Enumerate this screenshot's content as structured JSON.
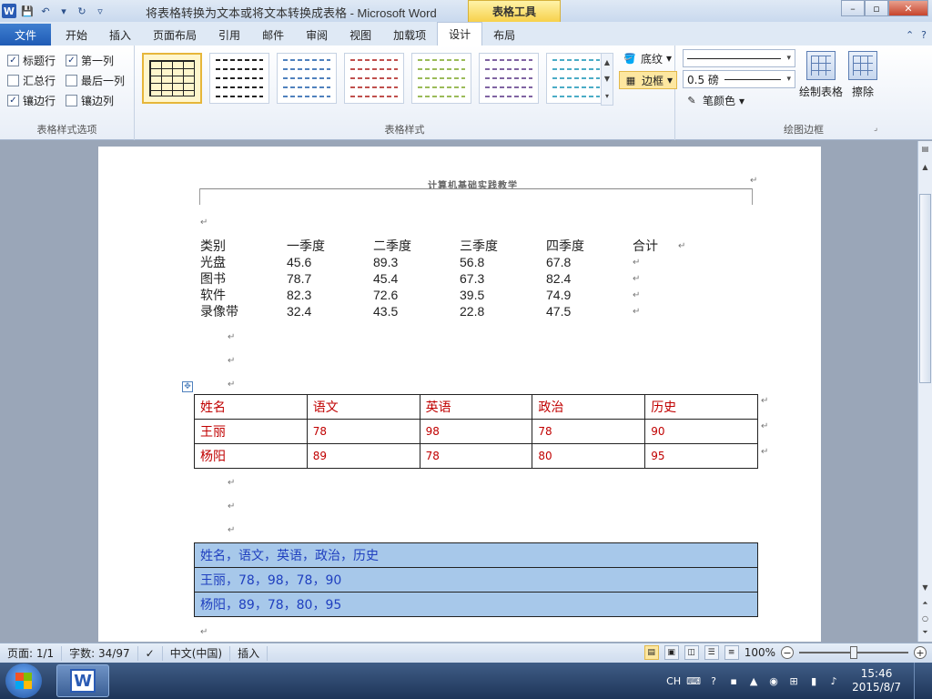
{
  "window": {
    "title": "将表格转换为文本或将文本转换成表格 - Microsoft Word",
    "context_tab": "表格工具",
    "word_icon": "W",
    "controls": {
      "minimize": "–",
      "restore": "▫",
      "close": "✕"
    }
  },
  "ribbon_tabs": {
    "file": "文件",
    "items": [
      "开始",
      "插入",
      "页面布局",
      "引用",
      "邮件",
      "审阅",
      "视图",
      "加载项",
      "设计",
      "布局"
    ],
    "active": "设计",
    "help": "?"
  },
  "style_options": {
    "label": "表格样式选项",
    "items": [
      {
        "label": "标题行",
        "checked": true
      },
      {
        "label": "第一列",
        "checked": true
      },
      {
        "label": "汇总行",
        "checked": false
      },
      {
        "label": "最后一列",
        "checked": false
      },
      {
        "label": "镶边行",
        "checked": true
      },
      {
        "label": "镶边列",
        "checked": false
      }
    ]
  },
  "table_styles": {
    "label": "表格样式",
    "thumb_colors": [
      "#222222",
      "#222222",
      "#4f81bd",
      "#c0504d",
      "#9bbb59",
      "#8064a2",
      "#4bacc6"
    ],
    "shading": "底纹",
    "borders": "边框"
  },
  "draw_borders": {
    "label": "绘图边框",
    "line_weight": "0.5 磅",
    "pen_color": "笔颜色",
    "draw_table": "绘制表格",
    "eraser": "擦除"
  },
  "document": {
    "header_text": "计算机基础实践教学",
    "para_mark": "↵",
    "tabbed_text": {
      "headers": [
        "类别",
        "一季度",
        "二季度",
        "三季度",
        "四季度",
        "合计"
      ],
      "rows": [
        [
          "光盘",
          "45.6",
          "89.3",
          "56.8",
          "67.8"
        ],
        [
          "图书",
          "78.7",
          "45.4",
          "67.3",
          "82.4"
        ],
        [
          "软件",
          "82.3",
          "72.6",
          "39.5",
          "74.9"
        ],
        [
          "录像带",
          "32.4",
          "43.5",
          "22.8",
          "47.5"
        ]
      ]
    },
    "grade_table": {
      "headers": [
        "姓名",
        "语文",
        "英语",
        "政治",
        "历史"
      ],
      "rows": [
        [
          "王丽",
          "78",
          "98",
          "78",
          "90"
        ],
        [
          "杨阳",
          "89",
          "78",
          "80",
          "95"
        ]
      ]
    },
    "csv_table": {
      "rows": [
        "姓名，语文，英语，政治，历史",
        "王丽，78，98，78，90",
        "杨阳，89，78，80，95"
      ]
    }
  },
  "status_bar": {
    "page": "页面: 1/1",
    "words": "字数: 34/97",
    "language": "中文(中国)",
    "mode": "插入",
    "zoom": "100%"
  },
  "taskbar": {
    "ime": "CH",
    "time": "15:46",
    "date": "2015/8/7"
  }
}
